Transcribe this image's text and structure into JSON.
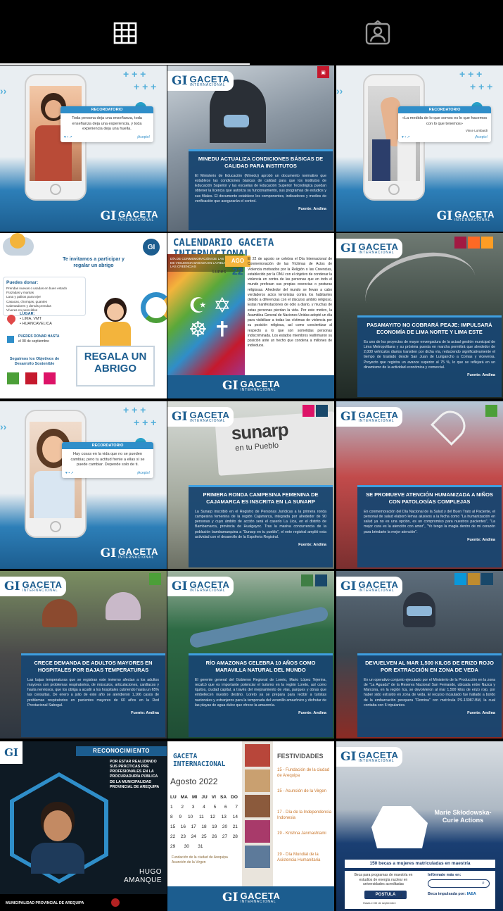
{
  "tabs": [
    {
      "name": "posts",
      "icon": "grid-icon"
    },
    {
      "name": "tagged",
      "icon": "tagged-person-icon"
    }
  ],
  "brand": {
    "gi": "GI",
    "name": "GACETA",
    "sub": "INTERNACIONAL",
    "name_full": "GACETA INTERNACIONAL"
  },
  "posts": {
    "p1": {
      "card_head": "RECORDATORIO",
      "quote": "Toda persona deja una enseñanza, toda enseñanza deja una experiencia, y toda experiencia deja una huella.",
      "cta": "¡Acepto!"
    },
    "p2": {
      "title": "MINEDU ACTUALIZA CONDICIONES BÁSICAS DE CALIDAD PARA INSTITUTOS",
      "body": "El Ministerio de Educación (Minedu) aprobó un documento normativo que establece las condiciones básicas de calidad para que los institutos de Educación Superior y las escuelas de Educación Superior Tecnológica puedan obtener la licencia que autoriza su funcionamiento, sus programas de estudios y sus filiales. El documento establece los componentes, indicadores y medios de verificación que asegurarán el control.",
      "source": "Fuente: Andina"
    },
    "p3": {
      "card_head": "RECORDATORIO",
      "quote": "«La medida de lo que somos es lo que hacemos con lo que tenemos»",
      "author": "Vince Lombardi",
      "cta": "¡Acepto!"
    },
    "p4": {
      "invite": "Te invitamos a participar y regalar un abrigo",
      "donate_head": "Puedes donar:",
      "donate_items": [
        "Prendas nuevas o usadas en buen estado",
        "Frazadas y mantas",
        "Lana y palitos para tejer",
        "Casacas, chompas, guantes",
        "Calentadores y demás prendas",
        "Víveres no perecibles"
      ],
      "place_label": "LUGAR:",
      "places": [
        "LIMA, VMT",
        "HUANCAVELICA"
      ],
      "date_label": "PUEDES DONAR HASTA",
      "date": "el 08 de septiembre",
      "goal_label": "Seguimos los Objetivos de Desarrollo Sostenible",
      "cta": "REGALA UN ABRIGO"
    },
    "p5": {
      "title": "CALENDARIO GACETA INTERNACIONAL",
      "month": "AGO",
      "day_name": "Lunes",
      "day": "22",
      "event": "DÍA DE CONMEMORACIÓN DE LAS VÍCTIMAS DE VIOLENCIA BASADA EN LA RELIGIÓN O LAS CREENCIAS",
      "body": "El 22 de agosto se celebra el Día Internacional de Conmemoración de las Víctimas de Actos de Violencia motivados por la Religión o las Creencias, establecido por la ONU con el objetivo de condenar la violencia en contra de las personas que en todo el mundo profesan sus propias creencias o posturas religiosas. Alrededor del mundo se llevan a cabo verdaderos actos terroristas contra los habitantes debido a diferencias con el discurso ambito religioso. Estas manifestaciones de odio a diario, y muchas de estas personas pierdan la vida. Por este motivo, la Asamblea General de Naciones Unidas adoptó un día para visibilizar a todas las víctimas de violencia por su posición religiosa, así como concientizar al respecto a lo que son sometidas personas indiscriminada. Los estados miembros reafirmaron su posición ante un hecho que condena a millones de individuos."
    },
    "p6": {
      "title": "PASAMAYITO NO COBRARÁ PEAJE: IMPULSARÁ ECONOMÍA DE LIMA NORTE Y LIMA ESTE",
      "body": "Es uno de los proyectos de mayor envergadura de la actual gestión municipal de Lima Metropolitana y su próxima puesta en marcha permitirá que alrededor de 2,000 vehículos diarios transiten por dicha vía, reduciendo significativamente el tiempo de traslado desde San Juan de Lurigancho a Comas y viceversa. Proyecto que registra un avance superior al 75 %, lo que se reflejará en un dinamismo de la actividad económica y comercial.",
      "source": "Fuente: Andina"
    },
    "p7": {
      "card_head": "RECORDATORIO",
      "quote": "Hay cosas en la vida que no se pueden cambiar, pero tu actitud frente a ellas sí se puede cambiar. Depende solo de ti.",
      "cta": "¡Acepto!"
    },
    "p8": {
      "banner": "sunarp",
      "banner_sub": "en tu Pueblo",
      "title": "PRIMERA RONDA CAMPESINA FEMENINA DE CAJAMARCA ES INSCRITA EN LA SUNARP",
      "body": "La Sunarp inscribió en el Registro de Personas Jurídicas a la primera ronda campesina femenina de la región Cajamarca, integrada por alrededor de 90 personas y cuyo ámbito de acción será el caserío La Lica, en el distrito de Bambamarca, provincia de Hualgayoc. Tras la masiva concurrencia de la población bambamarquina a \"Sunarp en tu pueblo\", el ente registral amplió esta actividad con el desarrollo de la Expoferia Registral.",
      "source": "Fuente: Andina"
    },
    "p9": {
      "title": "SE PROMUEVE ATENCIÓN HUMANIZADA A NIÑOS CON PATOLOGÍAS COMPLEJAS",
      "body": "En conmemoración del Día Nacional de la Salud y del Buen Trato al Paciente, el personal de salud elaboró lemas alusivos a la fecha como \"La humanización en salud ya no es una opción, es un compromiso para nuestros pacientes\", \"La mejor cura es la atención con amor\", \"Yo tengo la magia dentro de mi corazón para brindarte la mejor atención\".",
      "source": "Fuente: Andina"
    },
    "p10": {
      "title": "CRECE DEMANDA DE ADULTOS MAYORES EN HOSPITALES POR BAJAS TEMPERATURAS",
      "body": "Las bajas temperaturas que se registran este invierno afectan a los adultos mayores con problemas respiratorios, de músculos, articulaciones, cardíacos y hasta nerviosos, que los obliga a acudir a los hospitales cubriendo hasta un 65% las consultas. De enero a julio de este año se atendieron 1,166 casos de problemas respiratorios en pacientes mayores de 60 años en la Red Prestacional Sabogal.",
      "source": "Fuente: Andina"
    },
    "p11": {
      "title": "RÍO AMAZONAS CELEBRA 10 AÑOS COMO MARAVILLA NATURAL DEL MUNDO",
      "body": "El gerente general del Gobierno Regional de Loreto, Mario López Tejerina, recalcó que es importante potenciar el turismo en la región Loreto, así como Iquitos, ciudad capital, a través del mejoramiento de vías, parques y obras que embellecen nuestro destino. Loreto ya se prepara para recibir a turistas nacionales y extranjeros para la temporada del veranillo amazónico y disfrutar de las playas de agua dulce que ofrece la amazonía.",
      "source": "Fuente: Andina"
    },
    "p12": {
      "title": "DEVUELVEN AL MAR 1,500 KILOS DE ERIZO ROJO POR EXTRACCIÓN EN ZONA DE VEDA",
      "body": "En un operativo conjunto ejecutado por el Ministerio de la Producción en la zona de \"La Aguada\" de la Reserva Nacional San Fernando, ubicada entre Nazca y Marcona, en la región Ica, se devolvieron al mar 1,500 kilos de erizo rojo, por haber sido extraído en zona de veda. El recurso incautado fue hallado a bordo de la embarcación pesquera \"Romina\" con matrícula PS-13087-BM, la cual contaba con 6 tripulantes.",
      "source": "Fuente: Andina"
    },
    "p13": {
      "head": "RECONOCIMIENTO",
      "text": "POR ESTAR REALIZANDO SUS PRÁCTICAS PRE PROFESIONALES EN LA PROCURADURÍA PÚBLICA DE LA MUNICIPALIDAD PROVINCIAL DE AREQUIPA",
      "name_first": "HUGO",
      "name_last": "AMANQUE",
      "footer": "MUNICIPALIDAD PROVINCIAL DE AREQUIPA"
    },
    "p14": {
      "title": "GACETA INTERNACIONAL",
      "month": "Agosto 2022",
      "weekdays": [
        "LU",
        "MA",
        "MI",
        "JU",
        "VI",
        "SA",
        "DO"
      ],
      "weeks": [
        [
          "1",
          "2",
          "3",
          "4",
          "5",
          "6",
          "7"
        ],
        [
          "8",
          "9",
          "10",
          "11",
          "12",
          "13",
          "14"
        ],
        [
          "15",
          "16",
          "17",
          "18",
          "19",
          "20",
          "21"
        ],
        [
          "22",
          "23",
          "24",
          "25",
          "26",
          "27",
          "28"
        ],
        [
          "29",
          "30",
          "31",
          "",
          "",
          "",
          ""
        ]
      ],
      "festival_title": "FESTIVIDADES",
      "festivities": [
        "15 - Fundación de la ciudad de Arequipa",
        "15 - Asunción de la Virgen",
        "17 - Día de la Independencia Indonesia",
        "19 - Krishna Janmashtami",
        "19 - Día Mundial de la Asistencia Humanitaria"
      ],
      "note": "Fundación de la ciudad de Arequipa",
      "note2": "Asunción de la Virgen"
    },
    "p15": {
      "program": "Marie Skłodowska-Curie Actions",
      "title": "150 becas a mujeres matriculadas en maestría",
      "desc": "Beca para programas de maestría en estudios de energía nuclear en universidades acreditadas",
      "info": "Infórmate más en:",
      "cta": "POSTULA",
      "deadline": "Hasta el 30 de septiembre",
      "sponsor": "Beca impulsada por:",
      "sponsor_org": "IAEA"
    }
  }
}
